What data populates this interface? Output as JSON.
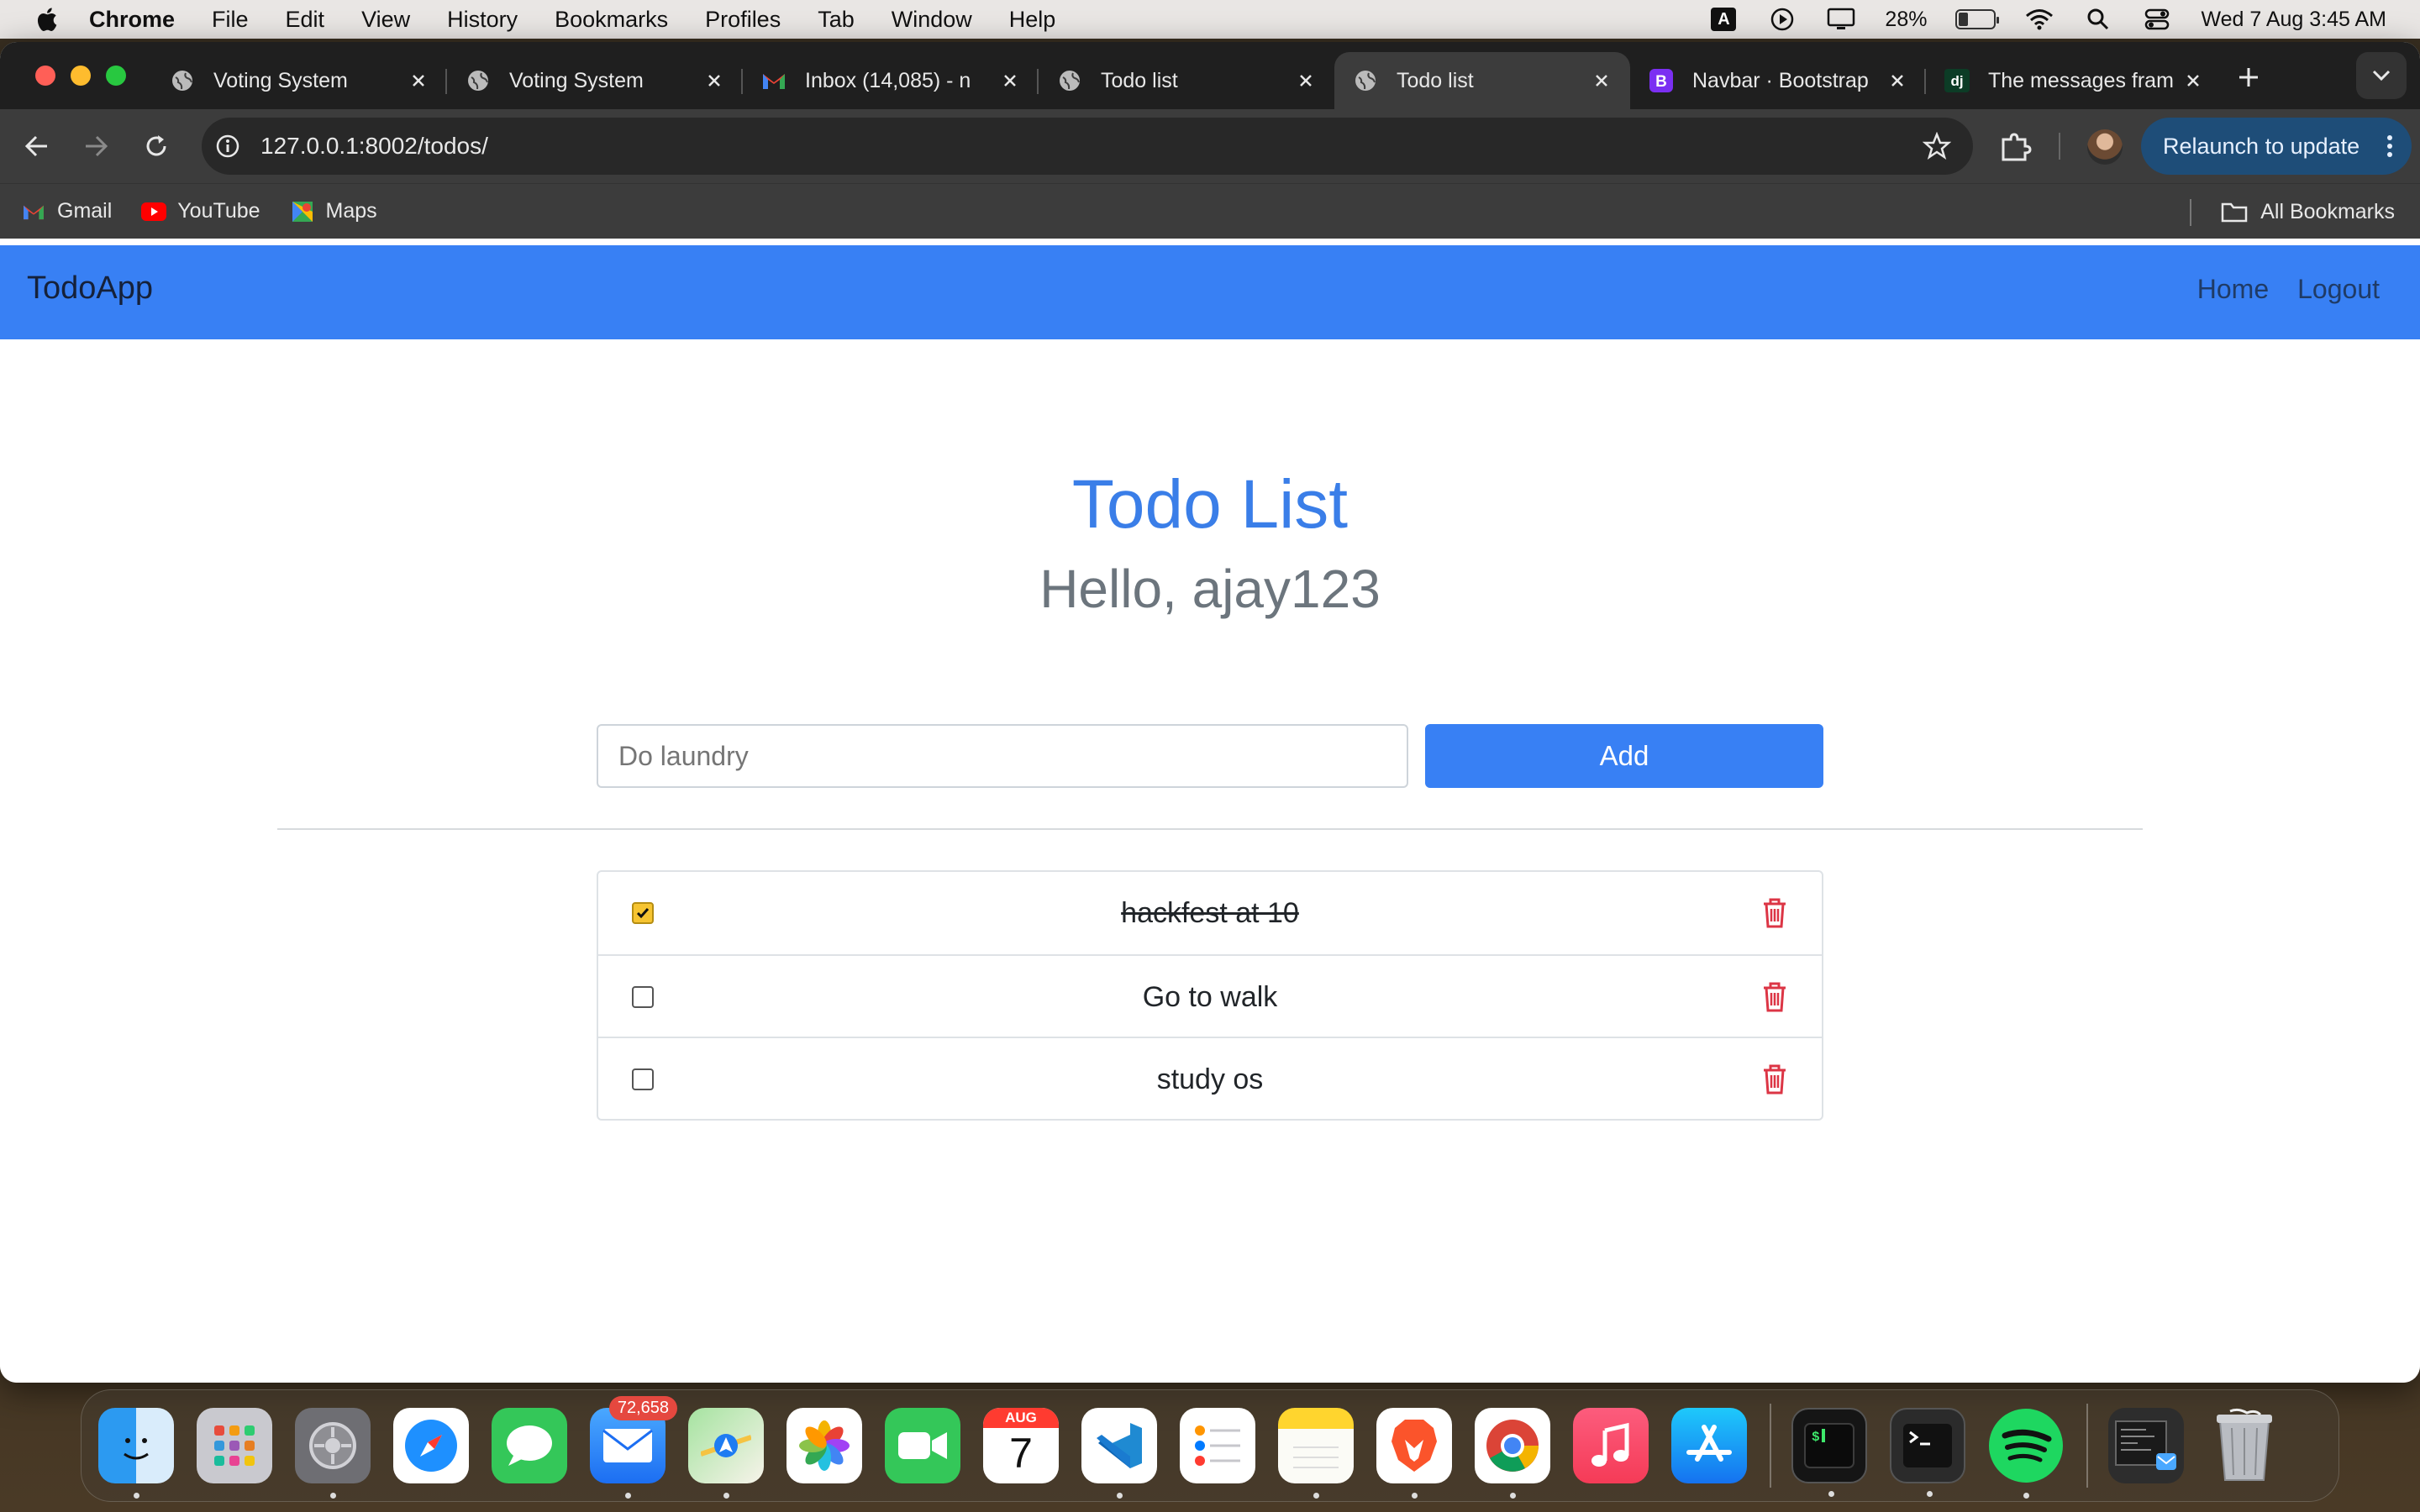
{
  "menubar": {
    "app_name": "Chrome",
    "items": [
      "File",
      "Edit",
      "View",
      "History",
      "Bookmarks",
      "Profiles",
      "Tab",
      "Window",
      "Help"
    ],
    "input_indicator": "A",
    "battery_percent": "28%",
    "battery_level": 0.28,
    "datetime": "Wed 7 Aug  3:45 AM"
  },
  "tabs": [
    {
      "title": "Voting System",
      "icon": "globe-icon"
    },
    {
      "title": "Voting System",
      "icon": "globe-icon"
    },
    {
      "title": "Inbox (14,085) - n",
      "icon": "gmail-icon"
    },
    {
      "title": "Todo list",
      "icon": "globe-icon"
    },
    {
      "title": "Todo list",
      "icon": "globe-icon",
      "active": true
    },
    {
      "title": "Navbar · Bootstrap",
      "icon": "bootstrap-icon"
    },
    {
      "title": "The messages fram",
      "icon": "django-icon"
    }
  ],
  "toolbar": {
    "url": "127.0.0.1:8002/todos/",
    "relaunch_label": "Relaunch to update"
  },
  "bookmarks": {
    "items": [
      {
        "label": "Gmail",
        "icon": "gmail-icon"
      },
      {
        "label": "YouTube",
        "icon": "youtube-icon"
      },
      {
        "label": "Maps",
        "icon": "maps-icon"
      }
    ],
    "all_label": "All Bookmarks"
  },
  "app": {
    "brand": "TodoApp",
    "nav": {
      "home": "Home",
      "logout": "Logout"
    },
    "title": "Todo List",
    "greeting": "Hello, ajay123",
    "new_todo_placeholder": "Do laundry",
    "add_label": "Add",
    "todos": [
      {
        "text": "hackfest at 10",
        "done": true
      },
      {
        "text": "Go to walk",
        "done": false
      },
      {
        "text": "study os",
        "done": false
      }
    ]
  },
  "dock": {
    "apps": [
      "finder",
      "launchpad",
      "system-settings",
      "safari",
      "messages",
      "mail",
      "maps",
      "photos",
      "facetime",
      "calendar",
      "vscode",
      "reminders",
      "notes",
      "brave",
      "chrome",
      "music",
      "app-store",
      "iterm",
      "terminal",
      "spotify",
      "downloads",
      "trash"
    ],
    "mail_badge": "72,658",
    "calendar_month": "AUG",
    "calendar_day": "7"
  },
  "colors": {
    "navbar": "#3880f4",
    "title": "#3a7ee8",
    "delete": "#dc3545",
    "checked": "#f6c431"
  }
}
